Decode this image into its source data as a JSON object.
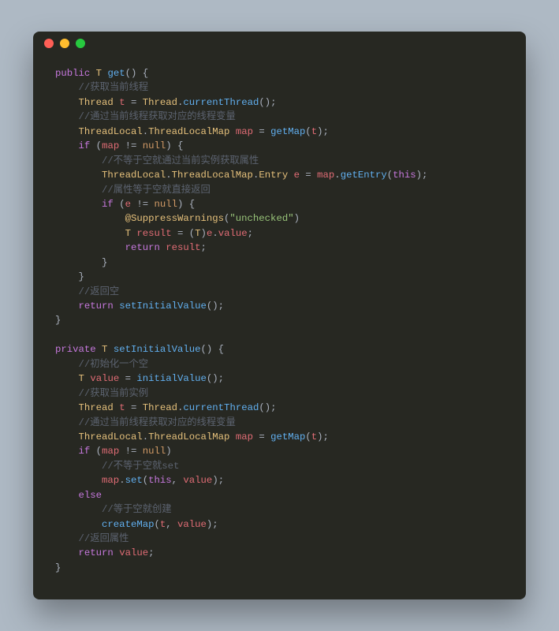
{
  "window": {
    "traffic_lights": [
      "red",
      "yellow",
      "green"
    ]
  },
  "code": {
    "tokens": [
      [
        [
          "kw",
          "public"
        ],
        [
          "p",
          " "
        ],
        [
          "type",
          "T"
        ],
        [
          "p",
          " "
        ],
        [
          "fn",
          "get"
        ],
        [
          "p",
          "() {"
        ]
      ],
      [
        [
          "p",
          "    "
        ],
        [
          "c",
          "//获取当前线程"
        ]
      ],
      [
        [
          "p",
          "    "
        ],
        [
          "type",
          "Thread"
        ],
        [
          "p",
          " "
        ],
        [
          "id",
          "t"
        ],
        [
          "p",
          " = "
        ],
        [
          "type",
          "Thread"
        ],
        [
          "p",
          "."
        ],
        [
          "fn",
          "currentThread"
        ],
        [
          "p",
          "();"
        ]
      ],
      [
        [
          "p",
          "    "
        ],
        [
          "c",
          "//通过当前线程获取对应的线程变量"
        ]
      ],
      [
        [
          "p",
          "    "
        ],
        [
          "type",
          "ThreadLocal"
        ],
        [
          "p",
          "."
        ],
        [
          "type",
          "ThreadLocalMap"
        ],
        [
          "p",
          " "
        ],
        [
          "id",
          "map"
        ],
        [
          "p",
          " = "
        ],
        [
          "fn",
          "getMap"
        ],
        [
          "p",
          "("
        ],
        [
          "id",
          "t"
        ],
        [
          "p",
          ");"
        ]
      ],
      [
        [
          "p",
          "    "
        ],
        [
          "kw",
          "if"
        ],
        [
          "p",
          " ("
        ],
        [
          "id",
          "map"
        ],
        [
          "p",
          " != "
        ],
        [
          "var",
          "null"
        ],
        [
          "p",
          ") {"
        ]
      ],
      [
        [
          "p",
          "        "
        ],
        [
          "c",
          "//不等于空就通过当前实例获取属性"
        ]
      ],
      [
        [
          "p",
          "        "
        ],
        [
          "type",
          "ThreadLocal"
        ],
        [
          "p",
          "."
        ],
        [
          "type",
          "ThreadLocalMap"
        ],
        [
          "p",
          "."
        ],
        [
          "type",
          "Entry"
        ],
        [
          "p",
          " "
        ],
        [
          "id",
          "e"
        ],
        [
          "p",
          " = "
        ],
        [
          "id",
          "map"
        ],
        [
          "p",
          "."
        ],
        [
          "fn",
          "getEntry"
        ],
        [
          "p",
          "("
        ],
        [
          "kw",
          "this"
        ],
        [
          "p",
          ");"
        ]
      ],
      [
        [
          "p",
          "        "
        ],
        [
          "c",
          "//属性等于空就直接返回"
        ]
      ],
      [
        [
          "p",
          "        "
        ],
        [
          "kw",
          "if"
        ],
        [
          "p",
          " ("
        ],
        [
          "id",
          "e"
        ],
        [
          "p",
          " != "
        ],
        [
          "var",
          "null"
        ],
        [
          "p",
          ") {"
        ]
      ],
      [
        [
          "p",
          "            "
        ],
        [
          "an",
          "@SuppressWarnings"
        ],
        [
          "p",
          "("
        ],
        [
          "s",
          "\"unchecked\""
        ],
        [
          "p",
          ")"
        ]
      ],
      [
        [
          "p",
          "            "
        ],
        [
          "type",
          "T"
        ],
        [
          "p",
          " "
        ],
        [
          "id",
          "result"
        ],
        [
          "p",
          " = ("
        ],
        [
          "type",
          "T"
        ],
        [
          "p",
          ")"
        ],
        [
          "id",
          "e"
        ],
        [
          "p",
          "."
        ],
        [
          "id",
          "value"
        ],
        [
          "p",
          ";"
        ]
      ],
      [
        [
          "p",
          "            "
        ],
        [
          "kw",
          "return"
        ],
        [
          "p",
          " "
        ],
        [
          "id",
          "result"
        ],
        [
          "p",
          ";"
        ]
      ],
      [
        [
          "p",
          "        }"
        ]
      ],
      [
        [
          "p",
          "    }"
        ]
      ],
      [
        [
          "p",
          "    "
        ],
        [
          "c",
          "//返回空"
        ]
      ],
      [
        [
          "p",
          "    "
        ],
        [
          "kw",
          "return"
        ],
        [
          "p",
          " "
        ],
        [
          "fn",
          "setInitialValue"
        ],
        [
          "p",
          "();"
        ]
      ],
      [
        [
          "p",
          "}"
        ]
      ],
      [
        [
          "p",
          ""
        ]
      ],
      [
        [
          "kw",
          "private"
        ],
        [
          "p",
          " "
        ],
        [
          "type",
          "T"
        ],
        [
          "p",
          " "
        ],
        [
          "fn",
          "setInitialValue"
        ],
        [
          "p",
          "() {"
        ]
      ],
      [
        [
          "p",
          "    "
        ],
        [
          "c",
          "//初始化一个空"
        ]
      ],
      [
        [
          "p",
          "    "
        ],
        [
          "type",
          "T"
        ],
        [
          "p",
          " "
        ],
        [
          "id",
          "value"
        ],
        [
          "p",
          " = "
        ],
        [
          "fn",
          "initialValue"
        ],
        [
          "p",
          "();"
        ]
      ],
      [
        [
          "p",
          "    "
        ],
        [
          "c",
          "//获取当前实例"
        ]
      ],
      [
        [
          "p",
          "    "
        ],
        [
          "type",
          "Thread"
        ],
        [
          "p",
          " "
        ],
        [
          "id",
          "t"
        ],
        [
          "p",
          " = "
        ],
        [
          "type",
          "Thread"
        ],
        [
          "p",
          "."
        ],
        [
          "fn",
          "currentThread"
        ],
        [
          "p",
          "();"
        ]
      ],
      [
        [
          "p",
          "    "
        ],
        [
          "c",
          "//通过当前线程获取对应的线程变量"
        ]
      ],
      [
        [
          "p",
          "    "
        ],
        [
          "type",
          "ThreadLocal"
        ],
        [
          "p",
          "."
        ],
        [
          "type",
          "ThreadLocalMap"
        ],
        [
          "p",
          " "
        ],
        [
          "id",
          "map"
        ],
        [
          "p",
          " = "
        ],
        [
          "fn",
          "getMap"
        ],
        [
          "p",
          "("
        ],
        [
          "id",
          "t"
        ],
        [
          "p",
          ");"
        ]
      ],
      [
        [
          "p",
          "    "
        ],
        [
          "kw",
          "if"
        ],
        [
          "p",
          " ("
        ],
        [
          "id",
          "map"
        ],
        [
          "p",
          " != "
        ],
        [
          "var",
          "null"
        ],
        [
          "p",
          ")"
        ]
      ],
      [
        [
          "p",
          "        "
        ],
        [
          "c",
          "//不等于空就set"
        ]
      ],
      [
        [
          "p",
          "        "
        ],
        [
          "id",
          "map"
        ],
        [
          "p",
          "."
        ],
        [
          "fn",
          "set"
        ],
        [
          "p",
          "("
        ],
        [
          "kw",
          "this"
        ],
        [
          "p",
          ", "
        ],
        [
          "id",
          "value"
        ],
        [
          "p",
          ");"
        ]
      ],
      [
        [
          "p",
          "    "
        ],
        [
          "kw",
          "else"
        ]
      ],
      [
        [
          "p",
          "        "
        ],
        [
          "c",
          "//等于空就创建"
        ]
      ],
      [
        [
          "p",
          "        "
        ],
        [
          "fn",
          "createMap"
        ],
        [
          "p",
          "("
        ],
        [
          "id",
          "t"
        ],
        [
          "p",
          ", "
        ],
        [
          "id",
          "value"
        ],
        [
          "p",
          ");"
        ]
      ],
      [
        [
          "p",
          "    "
        ],
        [
          "c",
          "//返回属性"
        ]
      ],
      [
        [
          "p",
          "    "
        ],
        [
          "kw",
          "return"
        ],
        [
          "p",
          " "
        ],
        [
          "id",
          "value"
        ],
        [
          "p",
          ";"
        ]
      ],
      [
        [
          "p",
          "}"
        ]
      ]
    ]
  }
}
